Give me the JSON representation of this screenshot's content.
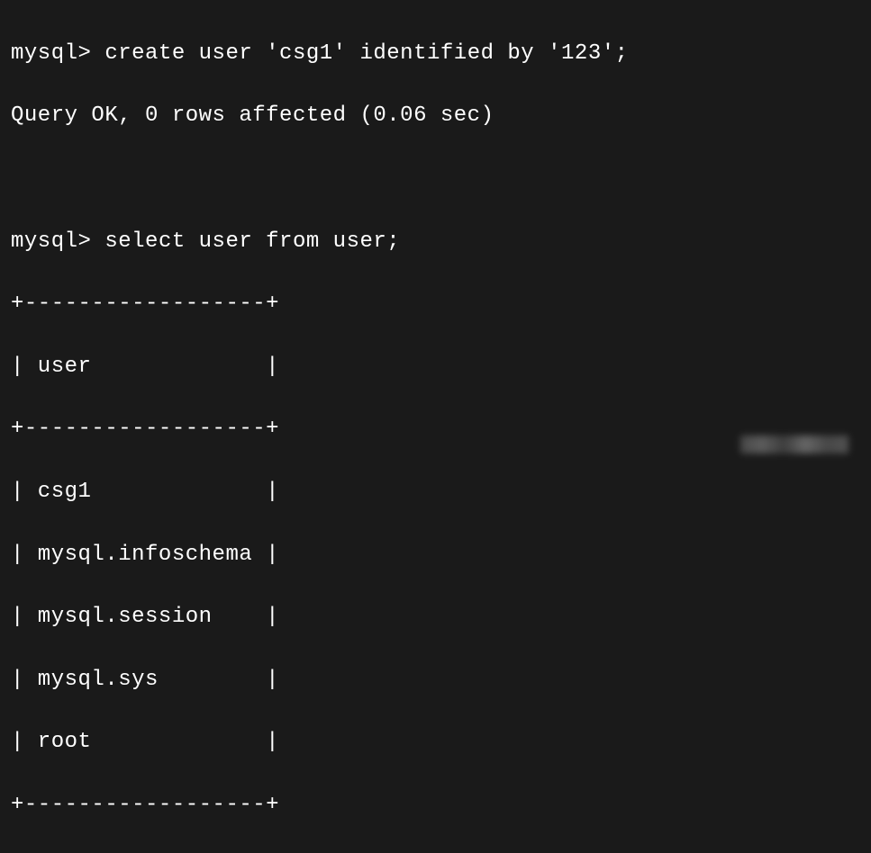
{
  "terminal": {
    "prompt": "mysql>",
    "command1": "create user 'csg1' identified by '123';",
    "response1": "Query OK, 0 rows affected (0.06 sec)",
    "command2": "select user from user;",
    "table": {
      "border_top": "+------------------+",
      "header": "| user             |",
      "border_mid": "+------------------+",
      "rows": [
        "| csg1             |",
        "| mysql.infoschema |",
        "| mysql.session    |",
        "| mysql.sys        |",
        "| root             |"
      ],
      "border_bottom": "+------------------+"
    }
  },
  "chart_data": {
    "type": "table",
    "title": "user",
    "columns": [
      "user"
    ],
    "rows": [
      [
        "csg1"
      ],
      [
        "mysql.infoschema"
      ],
      [
        "mysql.session"
      ],
      [
        "mysql.sys"
      ],
      [
        "root"
      ]
    ]
  }
}
